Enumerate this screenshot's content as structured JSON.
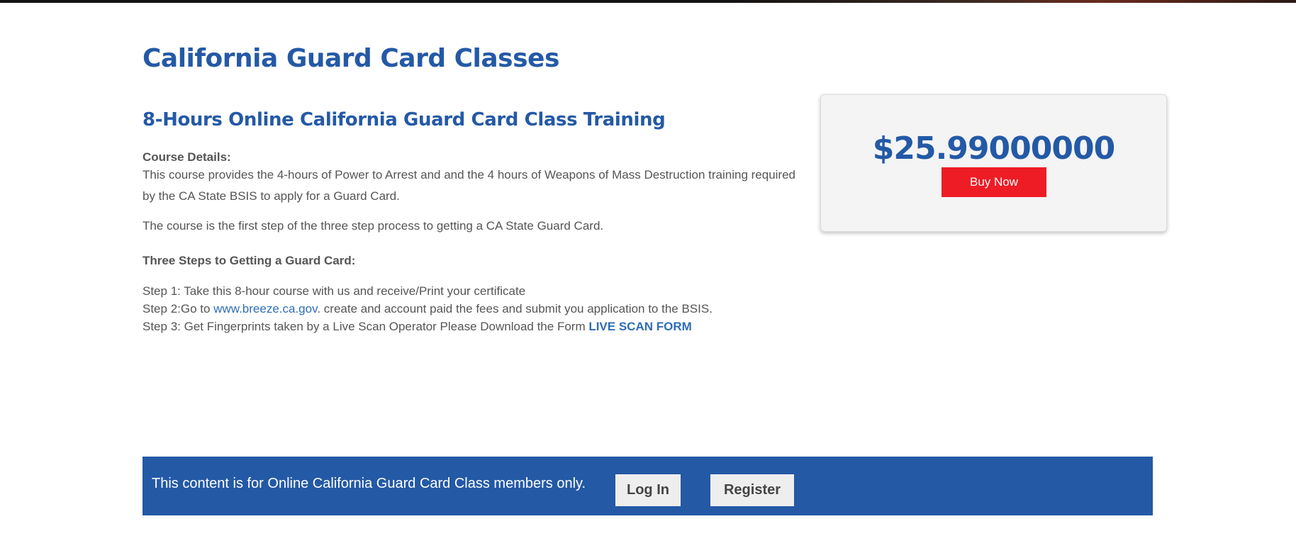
{
  "page": {
    "title": "California Guard Card Classes"
  },
  "course": {
    "heading": "8-Hours Online California Guard Card Class Training",
    "details_label": "Course Details:",
    "description": "This course provides the 4-hours of Power to Arrest and and the 4 hours of Weapons of Mass Destruction training required by the CA State BSIS to apply for a Guard Card.",
    "first_step_text": "The course is the first step of the three step process to getting a CA State Guard Card.",
    "steps_label": "Three Steps to Getting a Guard Card:",
    "step1": "Step 1: Take this 8-hour course with us  and receive/Print your certificate",
    "step2_prefix": "Step 2:Go to ",
    "step2_link": "www.breeze.ca.gov",
    "step2_suffix": ". create and account  paid the fees and submit you application to the BSIS.",
    "step3_prefix": "Step 3: Get Fingerprints taken by a Live Scan Operator Please Download the Form ",
    "step3_link": "LIVE SCAN  FORM"
  },
  "pricing": {
    "price": "$25.99000000",
    "buy_label": "Buy Now"
  },
  "membership": {
    "notice": "This content is for Online California Guard Card Class members only.",
    "login_label": "Log In",
    "register_label": "Register"
  },
  "colors": {
    "brand_blue": "#2459a6",
    "buy_red": "#ee1c25",
    "link_blue": "#2f6db5"
  }
}
